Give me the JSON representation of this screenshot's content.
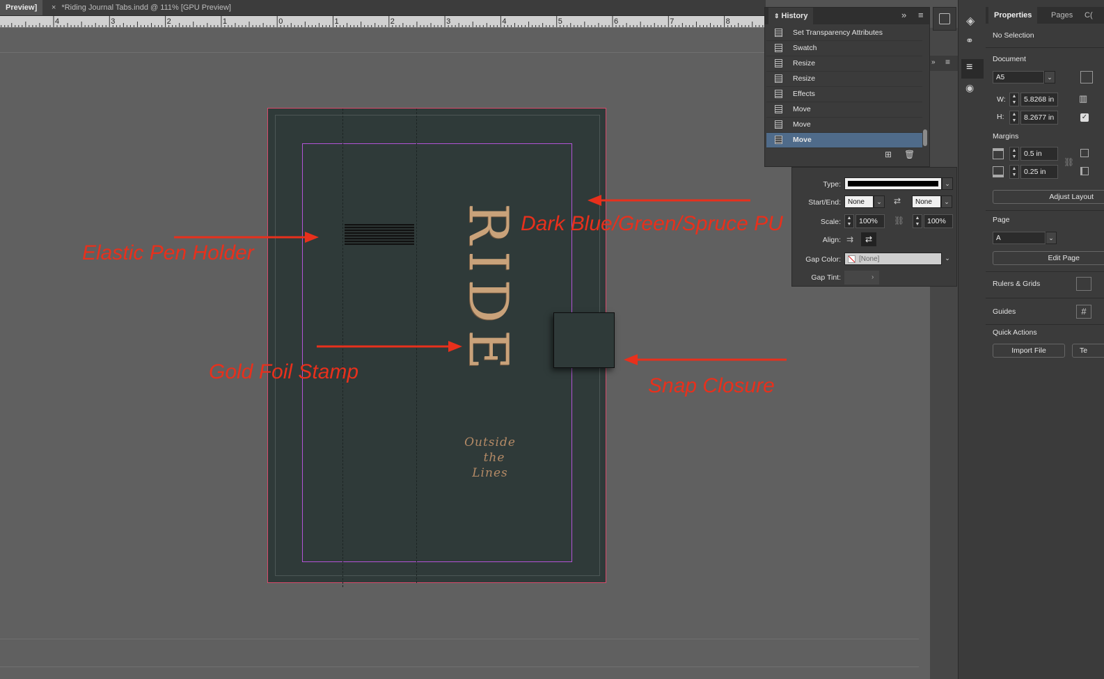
{
  "tabs": [
    {
      "label": "Preview]",
      "active": true
    },
    {
      "close": "×",
      "label": "*Riding Journal Tabs.indd @ 111% [GPU Preview]",
      "active": false
    }
  ],
  "ruler": {
    "labels": [
      "4",
      "3",
      "2",
      "1",
      "0",
      "1",
      "2",
      "3",
      "4",
      "5",
      "6",
      "7",
      "8"
    ]
  },
  "document": {
    "title_text": "RIDE",
    "script_lines": [
      "Outside",
      "the",
      "Lines"
    ]
  },
  "annotations": {
    "pen_holder": "Elastic Pen Holder",
    "material": "Dark Blue/Green/Spruce PU",
    "gold_foil": "Gold Foil Stamp",
    "snap": "Snap Closure",
    "color": "#e8301c"
  },
  "history": {
    "title": "History",
    "items": [
      {
        "label": "Set Transparency Attributes",
        "selected": false
      },
      {
        "label": "Swatch",
        "selected": false
      },
      {
        "label": "Resize",
        "selected": false
      },
      {
        "label": "Resize",
        "selected": false
      },
      {
        "label": "Effects",
        "selected": false
      },
      {
        "label": "Move",
        "selected": false
      },
      {
        "label": "Move",
        "selected": false
      },
      {
        "label": "Move",
        "selected": true
      }
    ]
  },
  "stroke": {
    "type_label": "Type:",
    "start_end_label": "Start/End:",
    "start_value": "None",
    "end_value": "None",
    "scale_label": "Scale:",
    "scale_start": "100%",
    "scale_end": "100%",
    "align_label": "Align:",
    "gap_color_label": "Gap Color:",
    "gap_color_value": "[None]",
    "gap_tint_label": "Gap Tint:"
  },
  "properties": {
    "tabs": [
      "Properties",
      "Pages",
      "C("
    ],
    "selection": "No Selection",
    "document_label": "Document",
    "preset": "A5",
    "w_label": "W:",
    "width": "5.8268 in",
    "h_label": "H:",
    "height": "8.2677 in",
    "margins_label": "Margins",
    "margin_top": "0.5 in",
    "margin_bottom": "0.25 in",
    "adjust_layout": "Adjust Layout",
    "page_label": "Page",
    "page_value": "A",
    "edit_page": "Edit Page",
    "rulers_grids": "Rulers & Grids",
    "guides": "Guides",
    "quick_actions": "Quick Actions",
    "import_file": "Import File",
    "te_btn": "Te"
  },
  "colors": {
    "page_bg": "#2f3a39",
    "gold": "#c9a27a",
    "selected_row": "#4f6b8a"
  }
}
